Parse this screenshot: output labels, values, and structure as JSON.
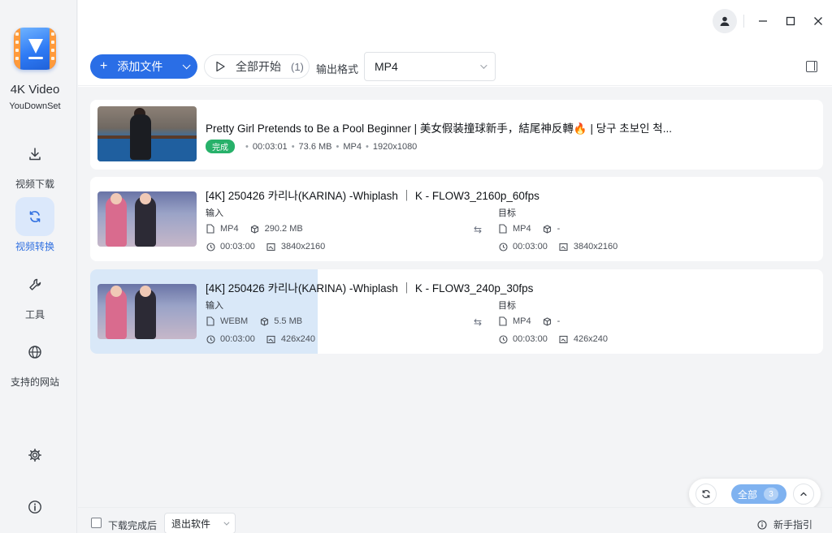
{
  "app": {
    "name": "4K Video",
    "subtitle": "YouDownSet"
  },
  "sidebar": {
    "items": [
      {
        "label": "视频下载",
        "icon": "download-icon"
      },
      {
        "label": "视频转换",
        "icon": "refresh-icon",
        "active": true
      },
      {
        "label": "工具",
        "icon": "wrench-icon"
      },
      {
        "label": "支持的网站",
        "icon": "globe-icon"
      }
    ],
    "bottom": [
      {
        "icon": "gear-icon"
      },
      {
        "icon": "info-icon"
      }
    ]
  },
  "toolbar": {
    "add_label": "添加文件",
    "start_label": "全部开始",
    "start_count": "(1)",
    "format_label": "输出格式",
    "format_value": "MP4"
  },
  "tasks": [
    {
      "title": "Pretty Girl Pretends to Be a Pool Beginner | 美女假装撞球新手，結尾神反轉🔥 | 당구 초보인 척...",
      "status": "完成",
      "duration": "00:03:01",
      "size": "73.6 MB",
      "format": "MP4",
      "resolution": "1920x1080"
    },
    {
      "title": "[4K] 250426 카리나(KARINA) -Whiplash ｜ K - FLOW3_2160p_60fps",
      "input_label": "输入",
      "target_label": "目标",
      "in_format": "MP4",
      "in_size": "290.2 MB",
      "in_duration": "00:03:00",
      "in_resolution": "3840x2160",
      "out_format": "MP4",
      "out_size": "-",
      "out_duration": "00:03:00",
      "out_resolution": "3840x2160"
    },
    {
      "title": "[4K] 250426 카리나(KARINA) -Whiplash ｜ K - FLOW3_240p_30fps",
      "input_label": "输入",
      "target_label": "目标",
      "in_format": "WEBM",
      "in_size": "5.5 MB",
      "in_duration": "00:03:00",
      "in_resolution": "426x240",
      "out_format": "MP4",
      "out_size": "-",
      "out_duration": "00:03:00",
      "out_resolution": "426x240"
    }
  ],
  "footer": {
    "after_download_label": "下载完成后",
    "after_download_value": "退出软件",
    "guide_label": "新手指引"
  },
  "float": {
    "all_label": "全部",
    "all_count": "3"
  },
  "colors": {
    "accent": "#2a6ee6",
    "success": "#27b16a",
    "active_nav_bg": "#dbe8fb"
  }
}
